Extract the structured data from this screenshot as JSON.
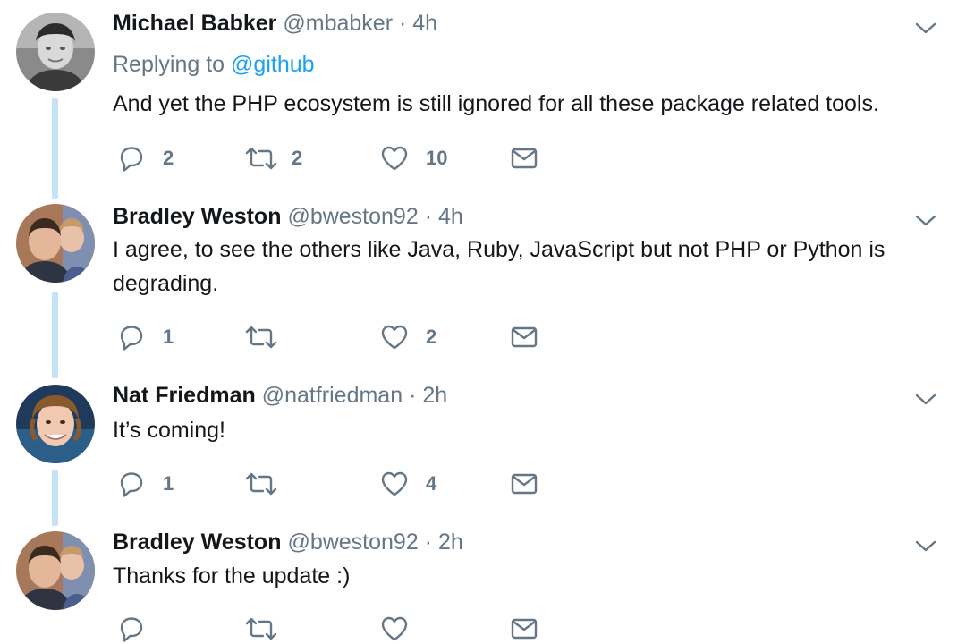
{
  "colors": {
    "text_primary": "#14171a",
    "text_secondary": "#657786",
    "link": "#1da1f2",
    "thread_line": "#c4e3f6"
  },
  "tweets": [
    {
      "name": "Michael Babker",
      "handle": "@mbabker",
      "separator": "·",
      "time": "4h",
      "replying_label": "Replying to",
      "replying_to": "@github",
      "text": "And yet the PHP ecosystem is still ignored for all these package related tools.",
      "replies": "2",
      "retweets": "2",
      "likes": "10",
      "icons": [
        "reply-icon",
        "retweet-icon",
        "like-icon",
        "message-icon",
        "caret-down-icon"
      ]
    },
    {
      "name": "Bradley Weston",
      "handle": "@bweston92",
      "separator": "·",
      "time": "4h",
      "text": "I agree, to see the others like Java, Ruby, JavaScript but not PHP or Python is degrading.",
      "replies": "1",
      "retweets": "",
      "likes": "2",
      "icons": [
        "reply-icon",
        "retweet-icon",
        "like-icon",
        "message-icon",
        "caret-down-icon"
      ]
    },
    {
      "name": "Nat Friedman",
      "handle": "@natfriedman",
      "separator": "·",
      "time": "2h",
      "text": "It’s coming!",
      "replies": "1",
      "retweets": "",
      "likes": "4",
      "icons": [
        "reply-icon",
        "retweet-icon",
        "like-icon",
        "message-icon",
        "caret-down-icon"
      ]
    },
    {
      "name": "Bradley Weston",
      "handle": "@bweston92",
      "separator": "·",
      "time": "2h",
      "text": "Thanks for the update :)",
      "replies": "",
      "retweets": "",
      "likes": "",
      "icons": [
        "reply-icon",
        "retweet-icon",
        "like-icon",
        "message-icon",
        "caret-down-icon"
      ]
    }
  ]
}
